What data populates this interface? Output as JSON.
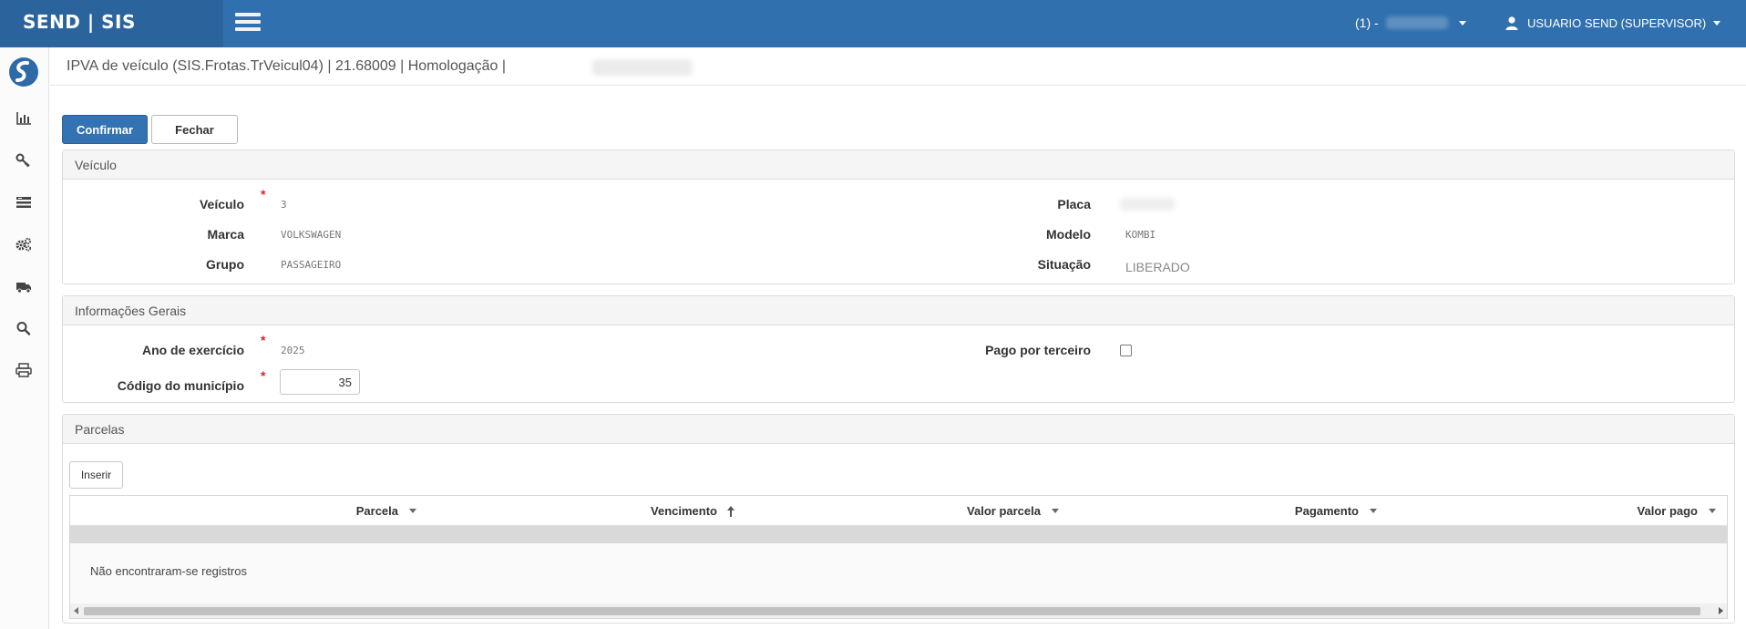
{
  "header": {
    "brand": "SEND | SIS",
    "company_prefix": "(1) -",
    "user_label": "USUARIO SEND (SUPERVISOR)"
  },
  "page": {
    "title": "IPVA de veículo (SIS.Frotas.TrVeicul04) | 21.68009 | Homologação |"
  },
  "toolbar": {
    "confirm_label": "Confirmar",
    "close_label": "Fechar"
  },
  "vehicle_panel": {
    "title": "Veículo",
    "veiculo_label": "Veículo",
    "veiculo_value": "3",
    "marca_label": "Marca",
    "marca_value": "VOLKSWAGEN",
    "grupo_label": "Grupo",
    "grupo_value": "PASSAGEIRO",
    "placa_label": "Placa",
    "modelo_label": "Modelo",
    "modelo_value": "KOMBI",
    "situacao_label": "Situação",
    "situacao_value": "LIBERADO"
  },
  "general_panel": {
    "title": "Informações Gerais",
    "ano_label": "Ano de exercício",
    "ano_value": "2025",
    "municipio_label": "Código do município",
    "municipio_value": "35",
    "pago_terceiro_label": "Pago por terceiro",
    "pago_terceiro_checked": false
  },
  "installments_panel": {
    "title": "Parcelas",
    "insert_label": "Inserir",
    "columns": [
      "Parcela",
      "Vencimento",
      "Valor parcela",
      "Pagamento",
      "Valor pago"
    ],
    "empty_message": "Não encontraram-se registros"
  },
  "colors": {
    "topbar": "#3170ae",
    "brand_bg": "#2b649d",
    "primary_button": "#3473b3",
    "required": "#e02020"
  },
  "icons": {
    "sidebar": [
      "chart-icon",
      "key-icon",
      "list-icon",
      "gears-icon",
      "truck-icon",
      "search-icon",
      "print-icon"
    ]
  }
}
